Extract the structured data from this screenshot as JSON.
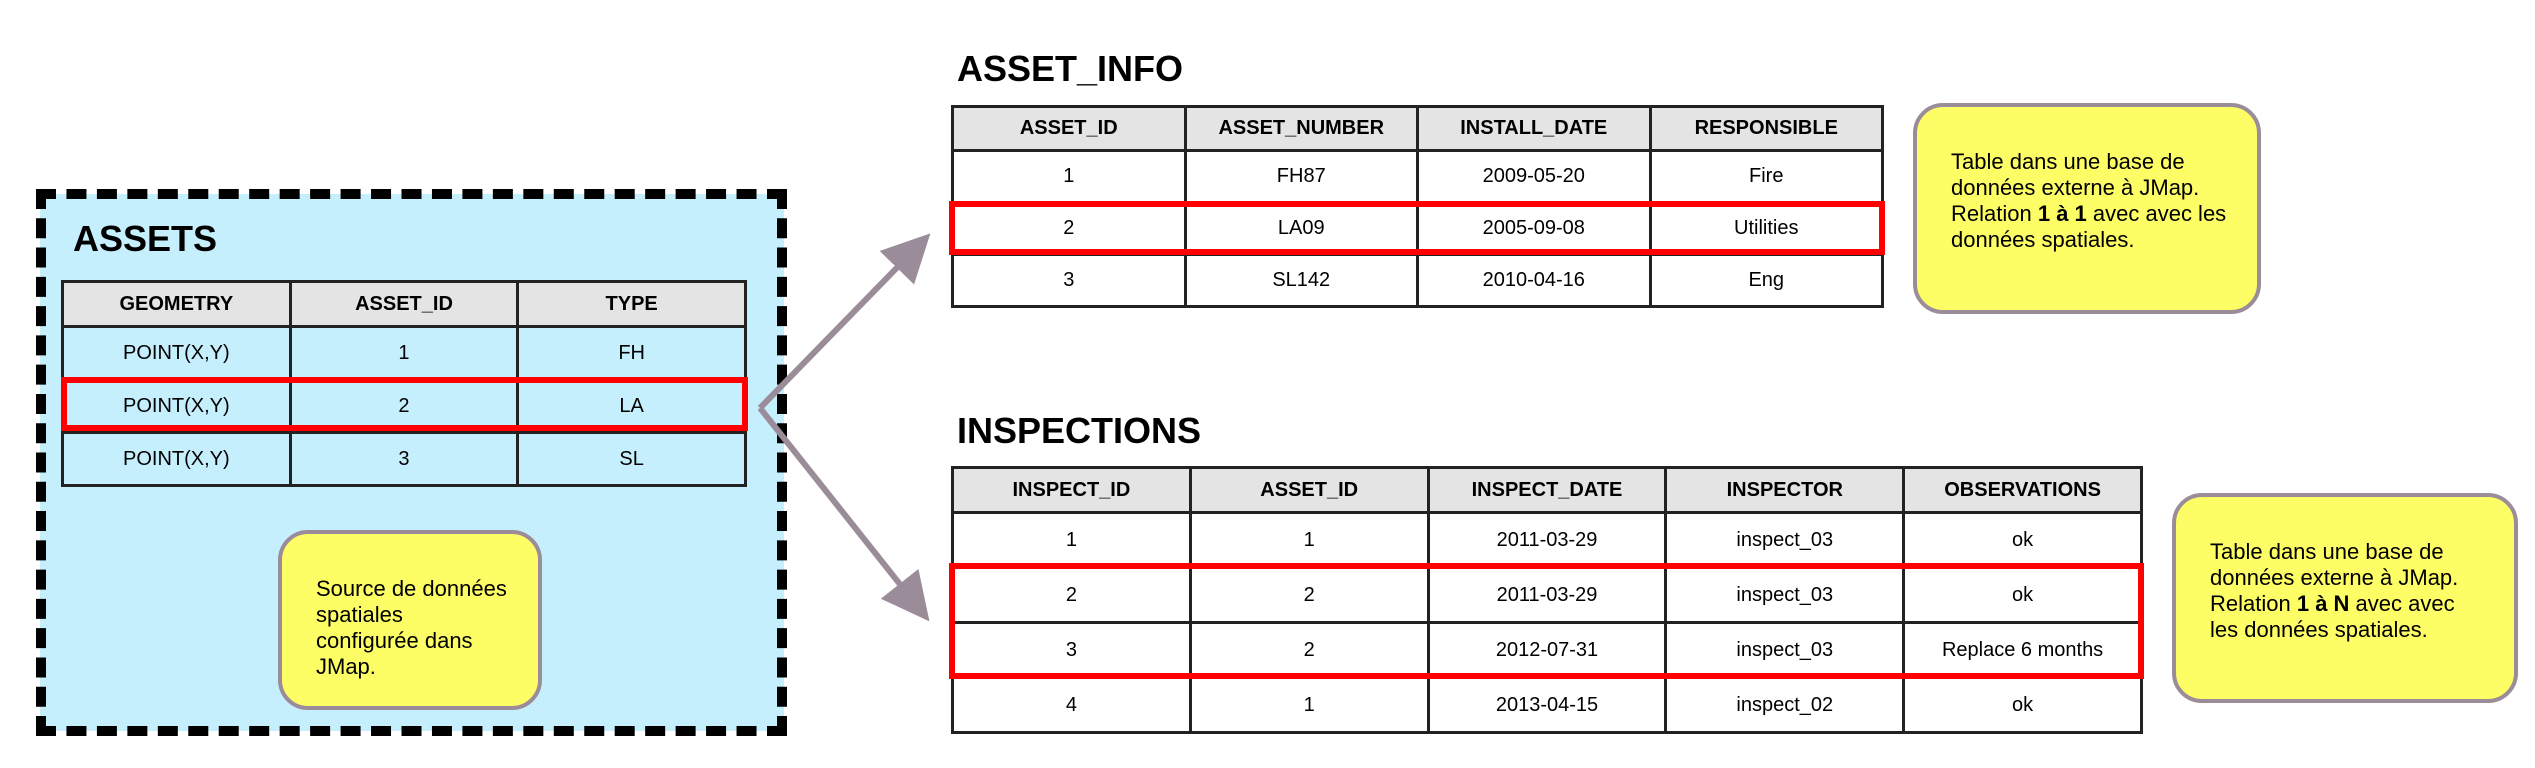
{
  "assets": {
    "title": "ASSETS",
    "columns": [
      "GEOMETRY",
      "ASSET_ID",
      "TYPE"
    ],
    "rows": [
      [
        "POINT(X,Y)",
        "1",
        "FH"
      ],
      [
        "POINT(X,Y)",
        "2",
        "LA"
      ],
      [
        "POINT(X,Y)",
        "3",
        "SL"
      ]
    ],
    "note": "Source de données spatiales configurée dans JMap."
  },
  "asset_info": {
    "title": "ASSET_INFO",
    "columns": [
      "ASSET_ID",
      "ASSET_NUMBER",
      "INSTALL_DATE",
      "RESPONSIBLE"
    ],
    "rows": [
      [
        "1",
        "FH87",
        "2009-05-20",
        "Fire"
      ],
      [
        "2",
        "LA09",
        "2005-09-08",
        "Utilities"
      ],
      [
        "3",
        "SL142",
        "2010-04-16",
        "Eng"
      ]
    ],
    "note_before": "Table dans une base de données externe à JMap. Relation ",
    "note_bold": "1 à 1",
    "note_after": " avec avec les données spatiales."
  },
  "inspections": {
    "title": "INSPECTIONS",
    "columns": [
      "INSPECT_ID",
      "ASSET_ID",
      "INSPECT_DATE",
      "INSPECTOR",
      "OBSERVATIONS"
    ],
    "rows": [
      [
        "1",
        "1",
        "2011-03-29",
        "inspect_03",
        "ok"
      ],
      [
        "2",
        "2",
        "2011-03-29",
        "inspect_03",
        "ok"
      ],
      [
        "3",
        "2",
        "2012-07-31",
        "inspect_03",
        "Replace 6 months"
      ],
      [
        "4",
        "1",
        "2013-04-15",
        "inspect_02",
        "ok"
      ]
    ],
    "note_before": "Table dans une base de données externe à JMap. Relation ",
    "note_bold": "1 à N",
    "note_after": " avec avec les données spatiales."
  },
  "colors": {
    "panel_fill": "#c6effd",
    "highlight": "#ff0000",
    "note_fill": "#fdfd66",
    "arrow": "#9a8c98",
    "header_fill": "#e4e4e4"
  }
}
